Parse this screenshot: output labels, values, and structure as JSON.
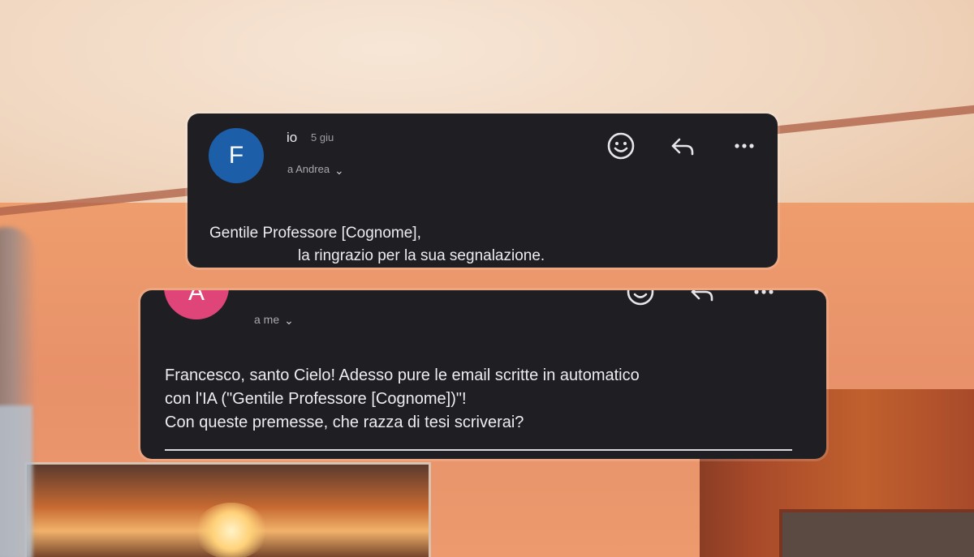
{
  "email_top": {
    "avatar_letter": "F",
    "sender": "io",
    "date": "5 giu",
    "recipient": "a Andrea",
    "greeting": "Gentile Professore [Cognome],",
    "body_line": "la ringrazio per la sua segnalazione.",
    "icons": [
      "emoji-reaction-icon",
      "reply-icon",
      "more-options-icon"
    ]
  },
  "email_bottom": {
    "avatar_letter": "A",
    "recipient": "a me",
    "lines": [
      "Francesco, santo Cielo! Adesso pure le email scritte in automatico",
      "con l'IA (\"Gentile Professore [Cognome])\"!",
      "Con queste premesse, che razza di tesi scriverai?"
    ],
    "icons": [
      "emoji-reaction-icon",
      "reply-icon",
      "more-options-icon"
    ]
  },
  "colors": {
    "card_bg": "#1e1e23",
    "avatar_f": "#1d5ea8",
    "avatar_a": "#e0457a"
  }
}
